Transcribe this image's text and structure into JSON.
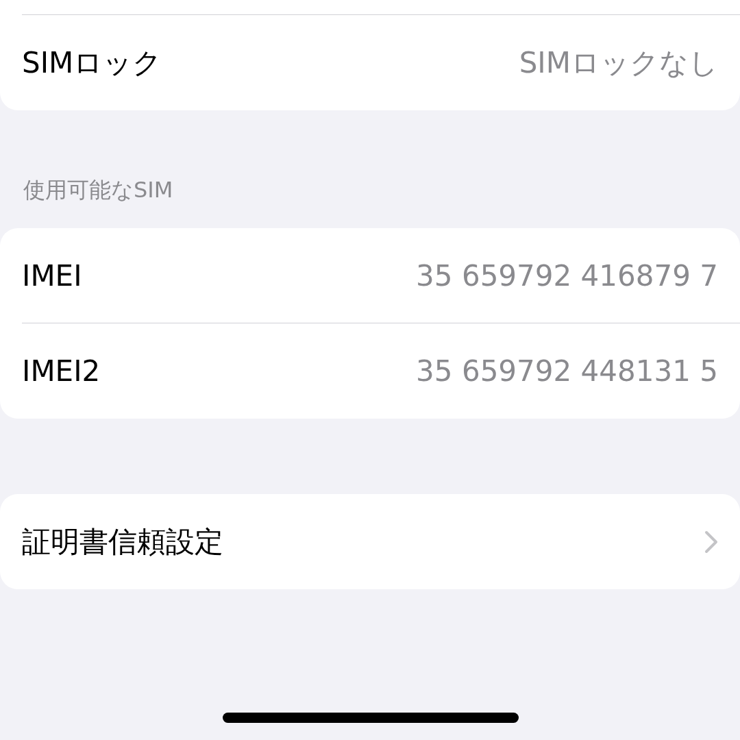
{
  "groups": [
    {
      "rows": [
        {
          "kind": "value",
          "label": "SIMロック",
          "value": "SIMロックなし"
        }
      ]
    },
    {
      "header": "使用可能なSIM",
      "rows": [
        {
          "kind": "value",
          "label": "IMEI",
          "value": "35 659792 416879 7"
        },
        {
          "kind": "value",
          "label": "IMEI2",
          "value": "35 659792 448131 5"
        }
      ]
    },
    {
      "rows": [
        {
          "kind": "link",
          "label": "証明書信頼設定"
        }
      ]
    }
  ]
}
